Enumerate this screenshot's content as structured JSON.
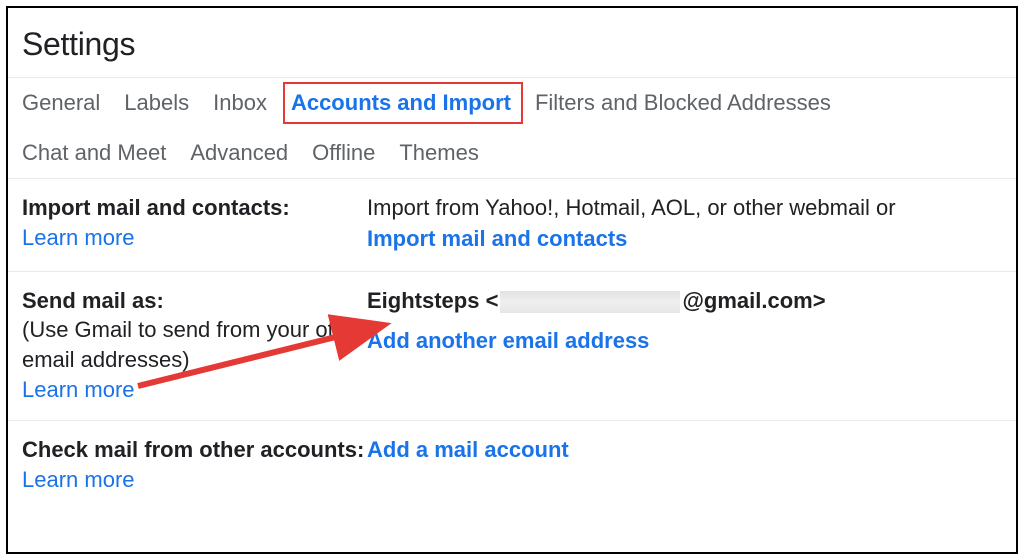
{
  "title": "Settings",
  "tabs_row1": [
    {
      "label": "General",
      "active": false
    },
    {
      "label": "Labels",
      "active": false
    },
    {
      "label": "Inbox",
      "active": false
    },
    {
      "label": "Accounts and Import",
      "active": true
    },
    {
      "label": "Filters and Blocked Addresses",
      "active": false
    }
  ],
  "tabs_row2": [
    {
      "label": "Chat and Meet",
      "active": false
    },
    {
      "label": "Advanced",
      "active": false
    },
    {
      "label": "Offline",
      "active": false
    },
    {
      "label": "Themes",
      "active": false
    }
  ],
  "sections": {
    "import": {
      "title": "Import mail and contacts:",
      "learn_more": "Learn more",
      "desc": "Import from Yahoo!, Hotmail, AOL, or other webmail or",
      "action": "Import mail and contacts"
    },
    "send_as": {
      "title": "Send mail as:",
      "sub": "(Use Gmail to send from your other email addresses)",
      "learn_more": "Learn more",
      "display_name": "Eightsteps",
      "email_prefix": "<",
      "email_suffix": "@gmail.com>",
      "action": "Add another email address"
    },
    "check_mail": {
      "title": "Check mail from other accounts:",
      "learn_more": "Learn more",
      "action": "Add a mail account"
    }
  }
}
